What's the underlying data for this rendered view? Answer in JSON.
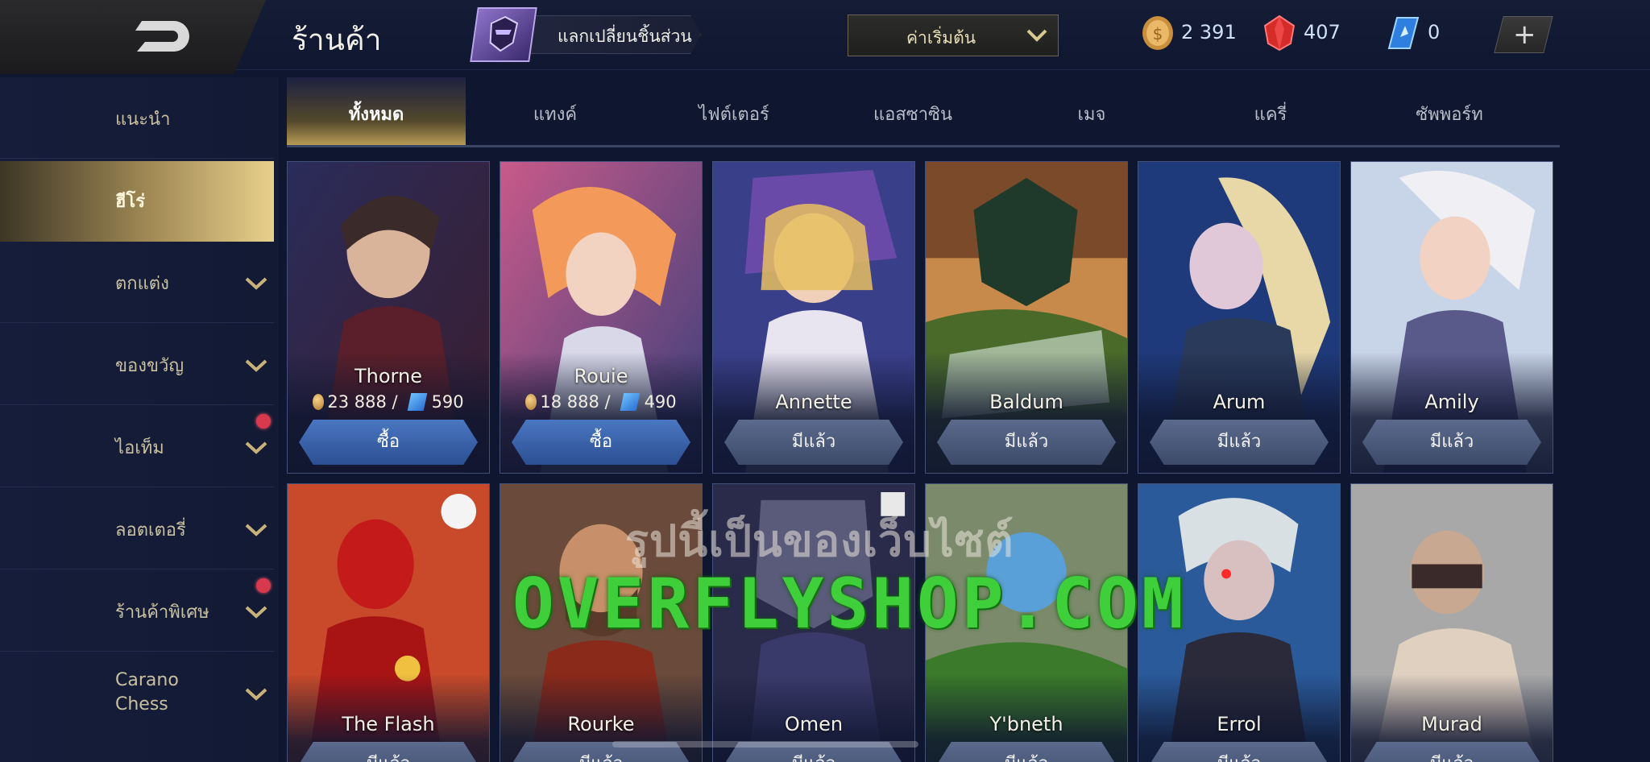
{
  "header": {
    "title": "ร้านค้า",
    "exchange_label": "แลกเปลี่ยนชิ้นส่วน",
    "sort_label": "ค่าเริ่มต้น",
    "gold": "2 391",
    "gems": "407",
    "vouchers": "0"
  },
  "sidebar": {
    "items": [
      {
        "label": "แนะนำ",
        "dropdown": false
      },
      {
        "label": "ฮีโร่",
        "dropdown": false,
        "active": true
      },
      {
        "label": "ตกแต่ง",
        "dropdown": true
      },
      {
        "label": "ของขวัญ",
        "dropdown": true
      },
      {
        "label": "ไอเท็ม",
        "dropdown": true,
        "badge": true
      },
      {
        "label": "ลอตเตอรี่",
        "dropdown": true
      },
      {
        "label": "ร้านค้าพิเศษ",
        "dropdown": true,
        "badge": true
      },
      {
        "label": "Carano Chess",
        "dropdown": true
      }
    ]
  },
  "tabs": [
    "ทั้งหมด",
    "แทงค์",
    "ไฟต์เตอร์",
    "แอสซาซิน",
    "เมจ",
    "แครี่",
    "ซัพพอร์ท"
  ],
  "heroes": [
    {
      "name": "Thorne",
      "gold_price": "23 888 /",
      "voucher_price": "590",
      "action": "ซื้อ",
      "owned": false
    },
    {
      "name": "Rouie",
      "gold_price": "18 888 /",
      "voucher_price": "490",
      "action": "ซื้อ",
      "owned": false
    },
    {
      "name": "Annette",
      "action": "มีแล้ว",
      "owned": true
    },
    {
      "name": "Baldum",
      "action": "มีแล้ว",
      "owned": true
    },
    {
      "name": "Arum",
      "action": "มีแล้ว",
      "owned": true
    },
    {
      "name": "Amily",
      "action": "มีแล้ว",
      "owned": true
    },
    {
      "name": "The Flash",
      "action": "มีแล้ว",
      "owned": true
    },
    {
      "name": "Rourke",
      "action": "มีแล้ว",
      "owned": true
    },
    {
      "name": "Omen",
      "action": "มีแล้ว",
      "owned": true
    },
    {
      "name": "Y'bneth",
      "action": "มีแล้ว",
      "owned": true
    },
    {
      "name": "Errol",
      "action": "มีแล้ว",
      "owned": true
    },
    {
      "name": "Murad",
      "action": "มีแล้ว",
      "owned": true
    }
  ],
  "watermark": {
    "line1": "รูปนี้เป็นของเว็บไซต์",
    "line2": "OVERFLYSHOP.COM"
  },
  "colors": {
    "accent_gold": "#b79b55",
    "buy_button": "#3a63aa",
    "owned_button": "#4c5a7c",
    "badge_red": "#d8394c",
    "watermark_green": "#3fcf3a"
  }
}
